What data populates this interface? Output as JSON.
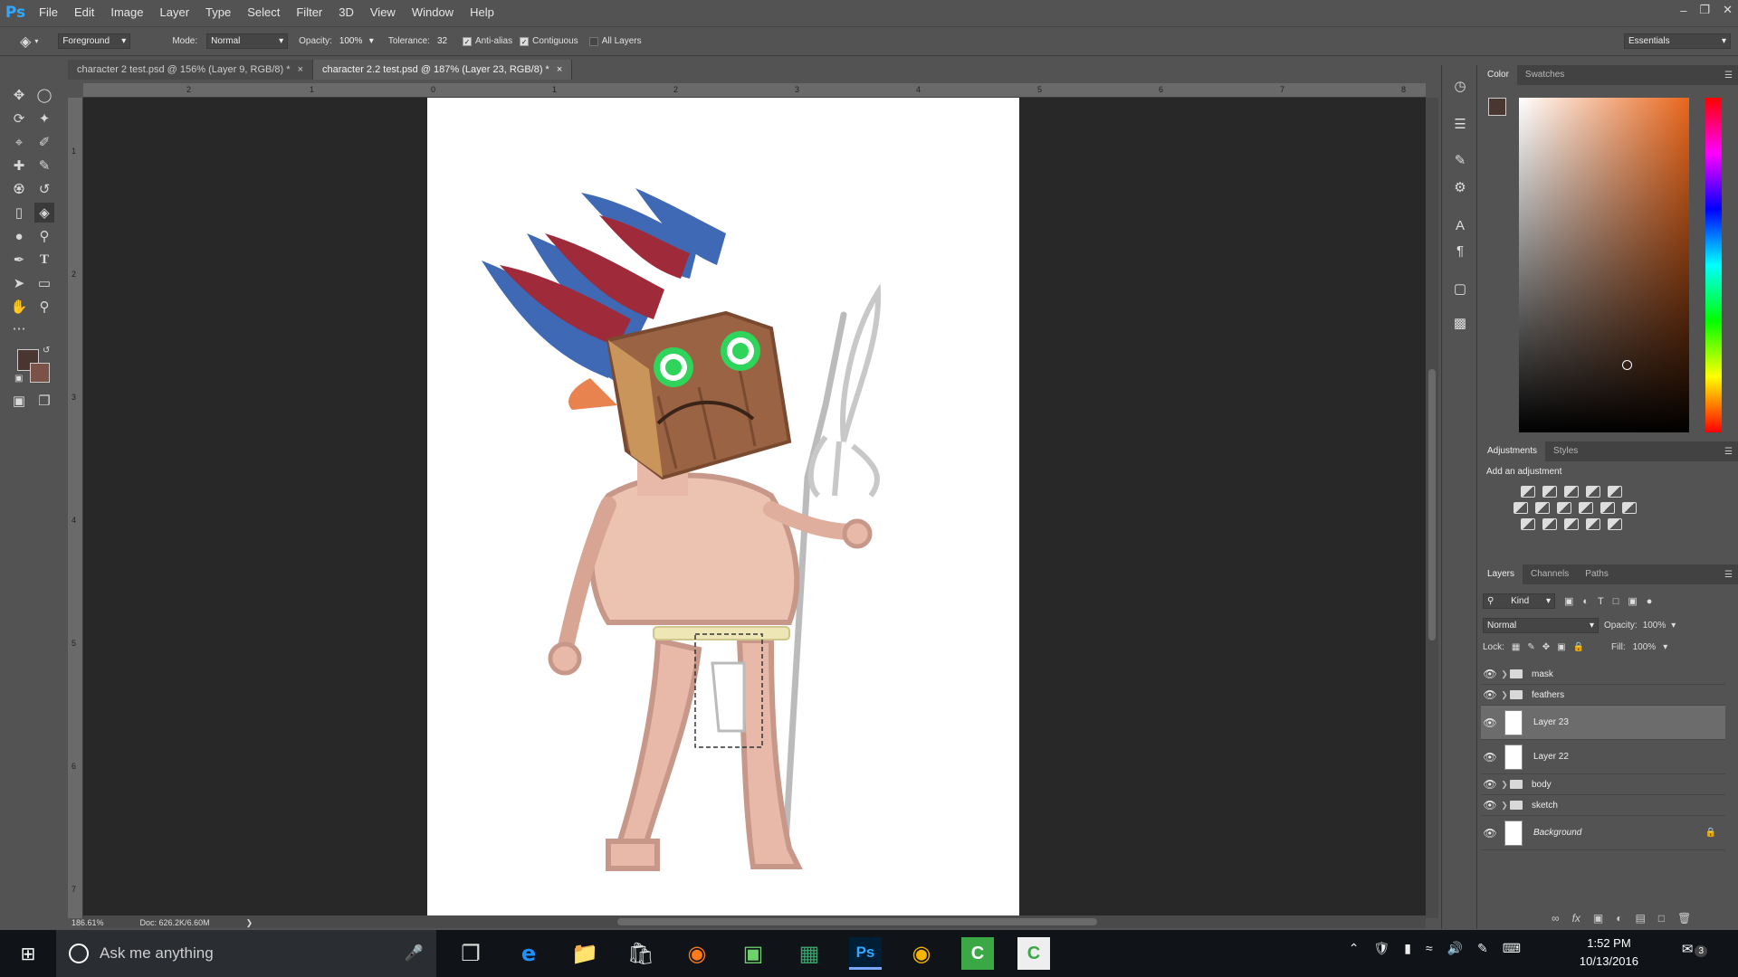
{
  "app": {
    "logo": "Ps"
  },
  "menu": [
    "File",
    "Edit",
    "Image",
    "Layer",
    "Type",
    "Select",
    "Filter",
    "3D",
    "View",
    "Window",
    "Help"
  ],
  "options": {
    "fill_source": "Foreground",
    "mode_label": "Mode:",
    "mode_value": "Normal",
    "opacity_label": "Opacity:",
    "opacity_value": "100%",
    "tolerance_label": "Tolerance:",
    "tolerance_value": "32",
    "anti_alias": "Anti-alias",
    "contiguous": "Contiguous",
    "all_layers": "All Layers",
    "workspace": "Essentials"
  },
  "tabs": [
    {
      "label": "character 2 test.psd @ 156% (Layer 9, RGB/8) *",
      "active": false
    },
    {
      "label": "character 2.2 test.psd @ 187% (Layer 23, RGB/8) *",
      "active": true
    }
  ],
  "rulers": {
    "h": [
      "2",
      "1",
      "0",
      "1",
      "2",
      "3",
      "4",
      "5",
      "6",
      "7",
      "8"
    ],
    "v": [
      "1",
      "2",
      "3",
      "4",
      "5",
      "6",
      "7"
    ]
  },
  "status": {
    "zoom": "186.61%",
    "doc": "Doc: 626.2K/6.60M"
  },
  "color_panel": {
    "tabs": [
      "Color",
      "Swatches"
    ],
    "fg": "#4a3630",
    "bg": "#7a5248",
    "hue": "#e8661c"
  },
  "adjustments": {
    "tabs": [
      "Adjustments",
      "Styles"
    ],
    "title": "Add an adjustment"
  },
  "layers_panel": {
    "tabs": [
      "Layers",
      "Channels",
      "Paths"
    ],
    "filter": "Kind",
    "blend": "Normal",
    "opacity_label": "Opacity:",
    "opacity_value": "100%",
    "lock_label": "Lock:",
    "fill_label": "Fill:",
    "fill_value": "100%",
    "layers": [
      {
        "name": "mask",
        "type": "group"
      },
      {
        "name": "feathers",
        "type": "group"
      },
      {
        "name": "Layer 23",
        "type": "layer",
        "selected": true
      },
      {
        "name": "Layer 22",
        "type": "layer"
      },
      {
        "name": "body",
        "type": "group"
      },
      {
        "name": "sketch",
        "type": "group"
      },
      {
        "name": "Background",
        "type": "background"
      }
    ]
  },
  "taskbar": {
    "search_placeholder": "Ask me anything",
    "time": "1:52 PM",
    "date": "10/13/2016",
    "notifications": "3"
  }
}
